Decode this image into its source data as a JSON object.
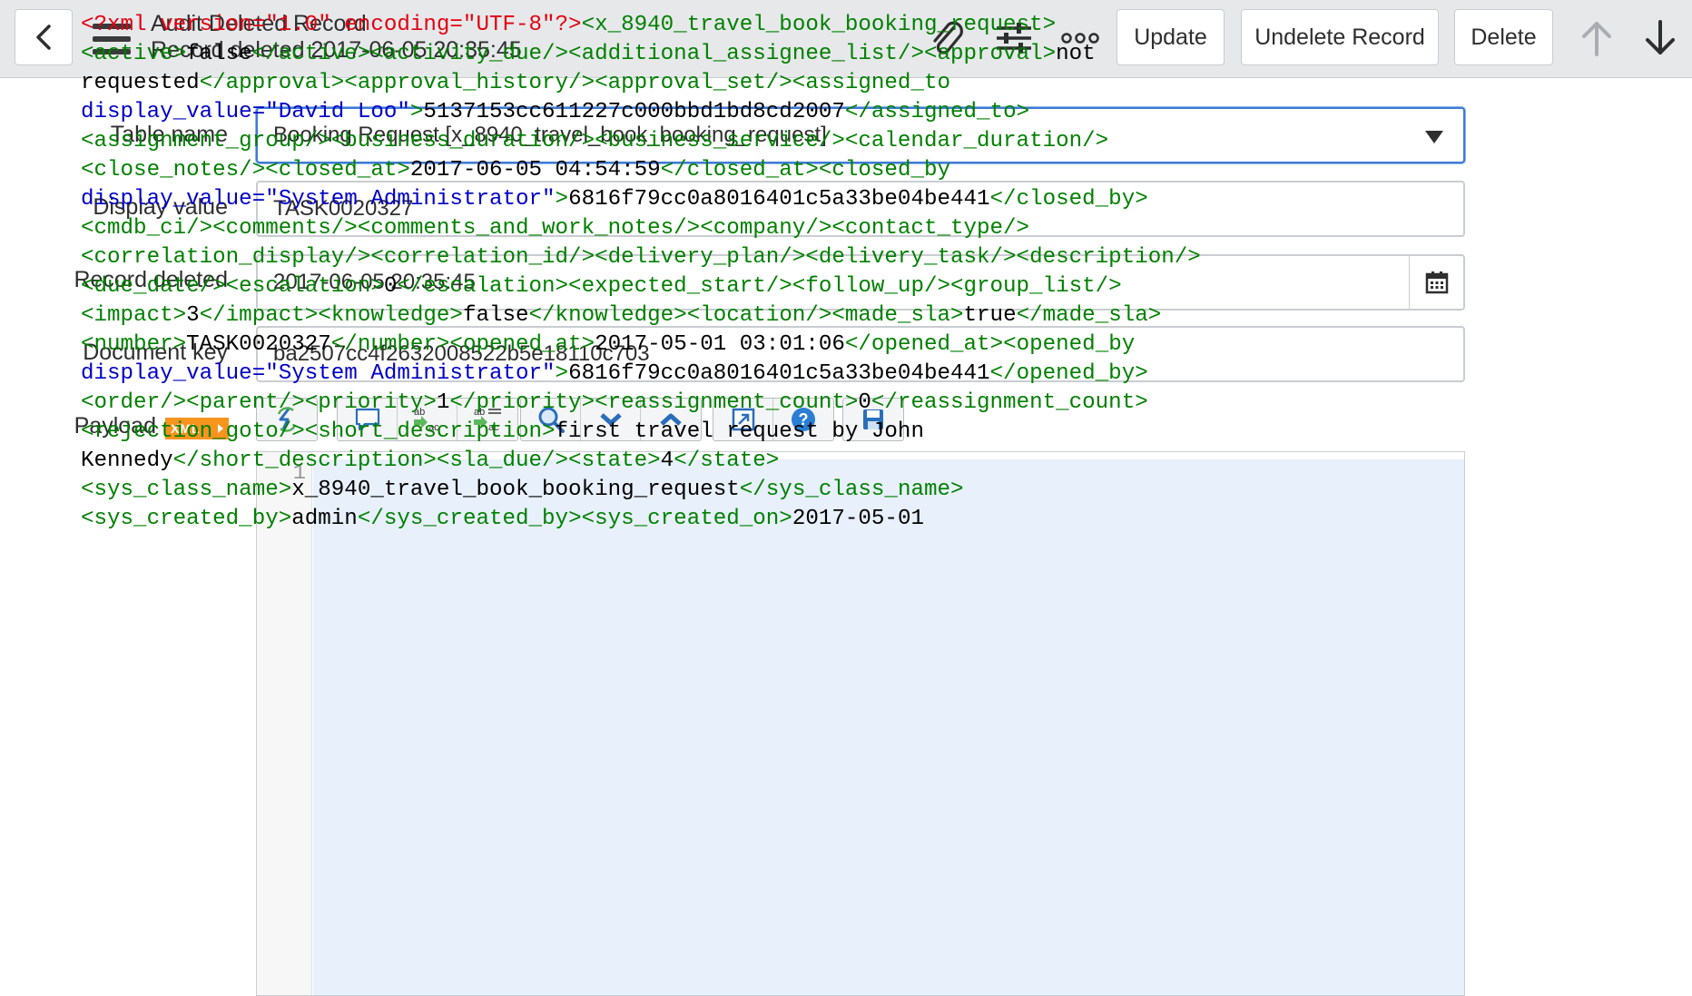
{
  "header": {
    "title": "Audit Deleted Record",
    "subtitle": "Record deleted 2017-06-05 20:35:45",
    "icons": [
      "back-chevron-icon",
      "hamburger-menu-icon",
      "paperclip-icon",
      "sliders-icon",
      "more-dots-icon",
      "arrow-up-icon",
      "arrow-down-icon"
    ],
    "buttons": {
      "update": "Update",
      "undelete": "Undelete Record",
      "delete": "Delete"
    }
  },
  "form": {
    "table_name": {
      "label": "Table name",
      "value": "Booking Request [x_8940_travel_book_booking_request]"
    },
    "display_value": {
      "label": "Display value",
      "value": "TASK0020327"
    },
    "record_deleted": {
      "label": "Record deleted",
      "value": "2017-06-05 20:35:45"
    },
    "document_key": {
      "label": "Document key",
      "value": "ba2507cc4f2632008522b5e18110c703"
    },
    "payload": {
      "label": "Payload",
      "badge": "XML"
    }
  },
  "editor": {
    "toolbar_icons": [
      "format-icon",
      "comment-icon",
      "replace-icon",
      "replace-all-icon",
      "search-icon",
      "fold-icon",
      "unfold-icon",
      "fullscreen-icon",
      "help-icon",
      "save-icon"
    ],
    "line_number": "1",
    "lines": [
      [
        [
          "pi",
          "<?xml version=\"1.0\" encoding=\"UTF-8\"?>"
        ],
        [
          "tag",
          "<x_8940_travel_book_booking_request>"
        ]
      ],
      [
        [
          "tag",
          "<active>"
        ],
        [
          "txt",
          "false"
        ],
        [
          "tag",
          "</active><activity_due/><additional_assignee_list/><approval>"
        ],
        [
          "txt",
          "not"
        ]
      ],
      [
        [
          "txt",
          "requested"
        ],
        [
          "tag",
          "</approval><approval_history/><approval_set/><assigned_to"
        ]
      ],
      [
        [
          "attr",
          "display_value="
        ],
        [
          "val",
          "\"David Loo\""
        ],
        [
          "tag",
          ">"
        ],
        [
          "txt",
          "5137153cc611227c000bbd1bd8cd2007"
        ],
        [
          "tag",
          "</assigned_to>"
        ]
      ],
      [
        [
          "tag",
          "<assignment_group/><business_duration/><business_service/><calendar_duration/>"
        ]
      ],
      [
        [
          "tag",
          "<close_notes/><closed_at>"
        ],
        [
          "txt",
          "2017-06-05 04:54:59"
        ],
        [
          "tag",
          "</closed_at><closed_by"
        ]
      ],
      [
        [
          "attr",
          "display_value="
        ],
        [
          "val",
          "\"System Administrator\""
        ],
        [
          "tag",
          ">"
        ],
        [
          "txt",
          "6816f79cc0a8016401c5a33be04be441"
        ],
        [
          "tag",
          "</closed_by>"
        ]
      ],
      [
        [
          "tag",
          "<cmdb_ci/><comments/><comments_and_work_notes/><company/><contact_type/>"
        ]
      ],
      [
        [
          "tag",
          "<correlation_display/><correlation_id/><delivery_plan/><delivery_task/><description/>"
        ]
      ],
      [
        [
          "tag",
          "<due_date/><escalation>"
        ],
        [
          "txt",
          "0"
        ],
        [
          "tag",
          "</escalation><expected_start/><follow_up/><group_list/>"
        ]
      ],
      [
        [
          "tag",
          "<impact>"
        ],
        [
          "txt",
          "3"
        ],
        [
          "tag",
          "</impact><knowledge>"
        ],
        [
          "txt",
          "false"
        ],
        [
          "tag",
          "</knowledge><location/><made_sla>"
        ],
        [
          "txt",
          "true"
        ],
        [
          "tag",
          "</made_sla>"
        ]
      ],
      [
        [
          "tag",
          "<number>"
        ],
        [
          "txt",
          "TASK0020327"
        ],
        [
          "tag",
          "</number><opened_at>"
        ],
        [
          "txt",
          "2017-05-01 03:01:06"
        ],
        [
          "tag",
          "</opened_at><opened_by"
        ]
      ],
      [
        [
          "attr",
          "display_value="
        ],
        [
          "val",
          "\"System Administrator\""
        ],
        [
          "tag",
          ">"
        ],
        [
          "txt",
          "6816f79cc0a8016401c5a33be04be441"
        ],
        [
          "tag",
          "</opened_by>"
        ]
      ],
      [
        [
          "tag",
          "<order/><parent/><priority>"
        ],
        [
          "txt",
          "1"
        ],
        [
          "tag",
          "</priority><reassignment_count>"
        ],
        [
          "txt",
          "0"
        ],
        [
          "tag",
          "</reassignment_count>"
        ]
      ],
      [
        [
          "tag",
          "<rejection_goto/><short_description>"
        ],
        [
          "txt",
          "first travel request by John"
        ]
      ],
      [
        [
          "txt",
          "Kennedy"
        ],
        [
          "tag",
          "</short_description><sla_due/><state>"
        ],
        [
          "txt",
          "4"
        ],
        [
          "tag",
          "</state>"
        ]
      ],
      [
        [
          "tag",
          "<sys_class_name>"
        ],
        [
          "txt",
          "x_8940_travel_book_booking_request"
        ],
        [
          "tag",
          "</sys_class_name>"
        ]
      ],
      [
        [
          "tag",
          "<sys_created_by>"
        ],
        [
          "txt",
          "admin"
        ],
        [
          "tag",
          "</sys_created_by><sys_created_on>"
        ],
        [
          "txt",
          "2017-05-01"
        ]
      ]
    ]
  },
  "colors": {
    "accent": "#3d7bd6",
    "xml_badge": "#f7941d",
    "code_bg": "#e7f0fb",
    "tag": "#008000",
    "attr": "#0000c8",
    "pi": "#e3000f"
  }
}
